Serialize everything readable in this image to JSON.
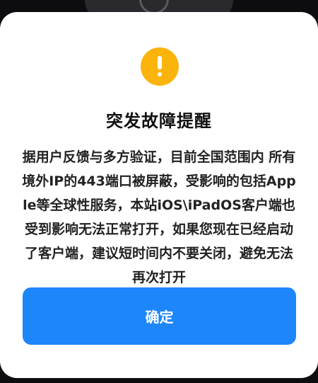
{
  "dialog": {
    "icon": "warning-icon",
    "title": "突发故障提醒",
    "message": "据用户反馈与多方验证，目前全国范围内 所有境外IP的443端口被屏蔽，受影响的包括Apple等全球性服务，本站iOS\\iPadOS客户端也受到影响无法正常打开，如果您现在已经启动了客户端，建议短时间内不要关闭，避免无法再次打开",
    "confirm_label": "确定"
  },
  "colors": {
    "warning": "#fbb40c",
    "accent": "#1e86fb",
    "backdrop": "#0d0d10"
  }
}
